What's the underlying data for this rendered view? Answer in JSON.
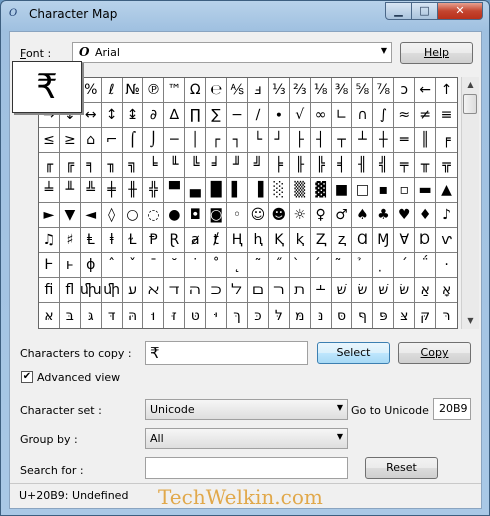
{
  "window": {
    "title": "Character Map",
    "minimize_glyph": "▁",
    "maximize_glyph": "□",
    "close_glyph": "✕"
  },
  "font": {
    "label": "Font :",
    "label_underline": "F",
    "label_rest": "ont :",
    "icon_glyph": "O",
    "value": "Arial",
    "help_label": "Help"
  },
  "zoom_char": "₹",
  "grid": {
    "rows": [
      [
        "!",
        "\"",
        "%",
        "ℓ",
        "№",
        "℗",
        "™",
        "Ω",
        "℮",
        "⅍",
        "ⅎ",
        "⅓",
        "⅔",
        "⅛",
        "⅜",
        "⅝",
        "⅞",
        "ↄ",
        "←",
        "↑"
      ],
      [
        "→",
        "↓",
        "↔",
        "↕",
        "↨",
        "∂",
        "∆",
        "∏",
        "∑",
        "−",
        "∕",
        "∙",
        "√",
        "∞",
        "∟",
        "∩",
        "∫",
        "≈",
        "≠",
        "≡"
      ],
      [
        "≤",
        "≥",
        "⌂",
        "⌐",
        "⌠",
        "⌡",
        "─",
        "│",
        "┌",
        "┐",
        "└",
        "┘",
        "├",
        "┤",
        "┬",
        "┴",
        "┼",
        "═",
        "║",
        "╒"
      ],
      [
        "╓",
        "╔",
        "╕",
        "╖",
        "╗",
        "╘",
        "╙",
        "╚",
        "╛",
        "╜",
        "╝",
        "╞",
        "╟",
        "╠",
        "╡",
        "╢",
        "╣",
        "╤",
        "╥",
        "╦"
      ],
      [
        "╧",
        "╨",
        "╩",
        "╪",
        "╫",
        "╬",
        "▀",
        "▄",
        "█",
        "▌",
        "▐",
        "░",
        "▒",
        "▓",
        "■",
        "□",
        "▪",
        "▫",
        "▬",
        "▲"
      ],
      [
        "►",
        "▼",
        "◄",
        "◊",
        "○",
        "◌",
        "●",
        "◘",
        "◙",
        "◦",
        "☺",
        "☻",
        "☼",
        "♀",
        "♂",
        "♠",
        "♣",
        "♥",
        "♦",
        "♪"
      ],
      [
        "♫",
        "♯",
        "Ⱡ",
        "ⱡ",
        "Ɫ",
        "Ᵽ",
        "Ɽ",
        "ⱥ",
        "ⱦ",
        "Ⱨ",
        "ⱨ",
        "Ⱪ",
        "ⱪ",
        "Ⱬ",
        "ⱬ",
        "Ɑ",
        "Ɱ",
        "Ɐ",
        "Ɒ",
        "ⱱ"
      ],
      [
        "Ⱶ",
        "ⱶ",
        "ɸ",
        "ˆ",
        "ˇ",
        "ˉ",
        "˘",
        "˙",
        "˚",
        "˛",
        "˜",
        "˝",
        "̀",
        "́",
        "̃",
        "̉",
        "̣",
        "΄",
        "΅",
        "·"
      ],
      [
        "ﬁ",
        "ﬂ",
        "ﬗ",
        "ﬕ",
        "ﬠ",
        "ﬡ",
        "ﬢ",
        "ﬣ",
        "ﬤ",
        "ﬥ",
        "ﬦ",
        "ﬧ",
        "ﬨ",
        "﬩",
        "שׁ",
        "שׂ",
        "שּׁ",
        "שּׂ",
        "אַ",
        "אָ"
      ],
      [
        "אּ",
        "בּ",
        "גּ",
        "דּ",
        "הּ",
        "וּ",
        "זּ",
        "טּ",
        "יּ",
        "ךּ",
        "כּ",
        "לּ",
        "מּ",
        "נּ",
        "סּ",
        "ףּ",
        "פּ",
        "צּ",
        "קּ",
        "רּ"
      ]
    ]
  },
  "copy": {
    "label": "Characters to copy :",
    "label_underline": "h",
    "value": "₹",
    "select_label": "Select",
    "copy_label": "Copy"
  },
  "advanced": {
    "label": "Advanced view",
    "checked": true
  },
  "charset": {
    "label": "Character set :",
    "value": "Unicode",
    "goto_label": "Go to Unicode :",
    "goto_value": "20B9"
  },
  "groupby": {
    "label": "Group by :",
    "value": "All"
  },
  "search": {
    "label": "Search for :",
    "value": "",
    "reset_label": "Reset"
  },
  "status": {
    "text": "U+20B9: Undefined",
    "watermark": "TechWelkin.com"
  }
}
